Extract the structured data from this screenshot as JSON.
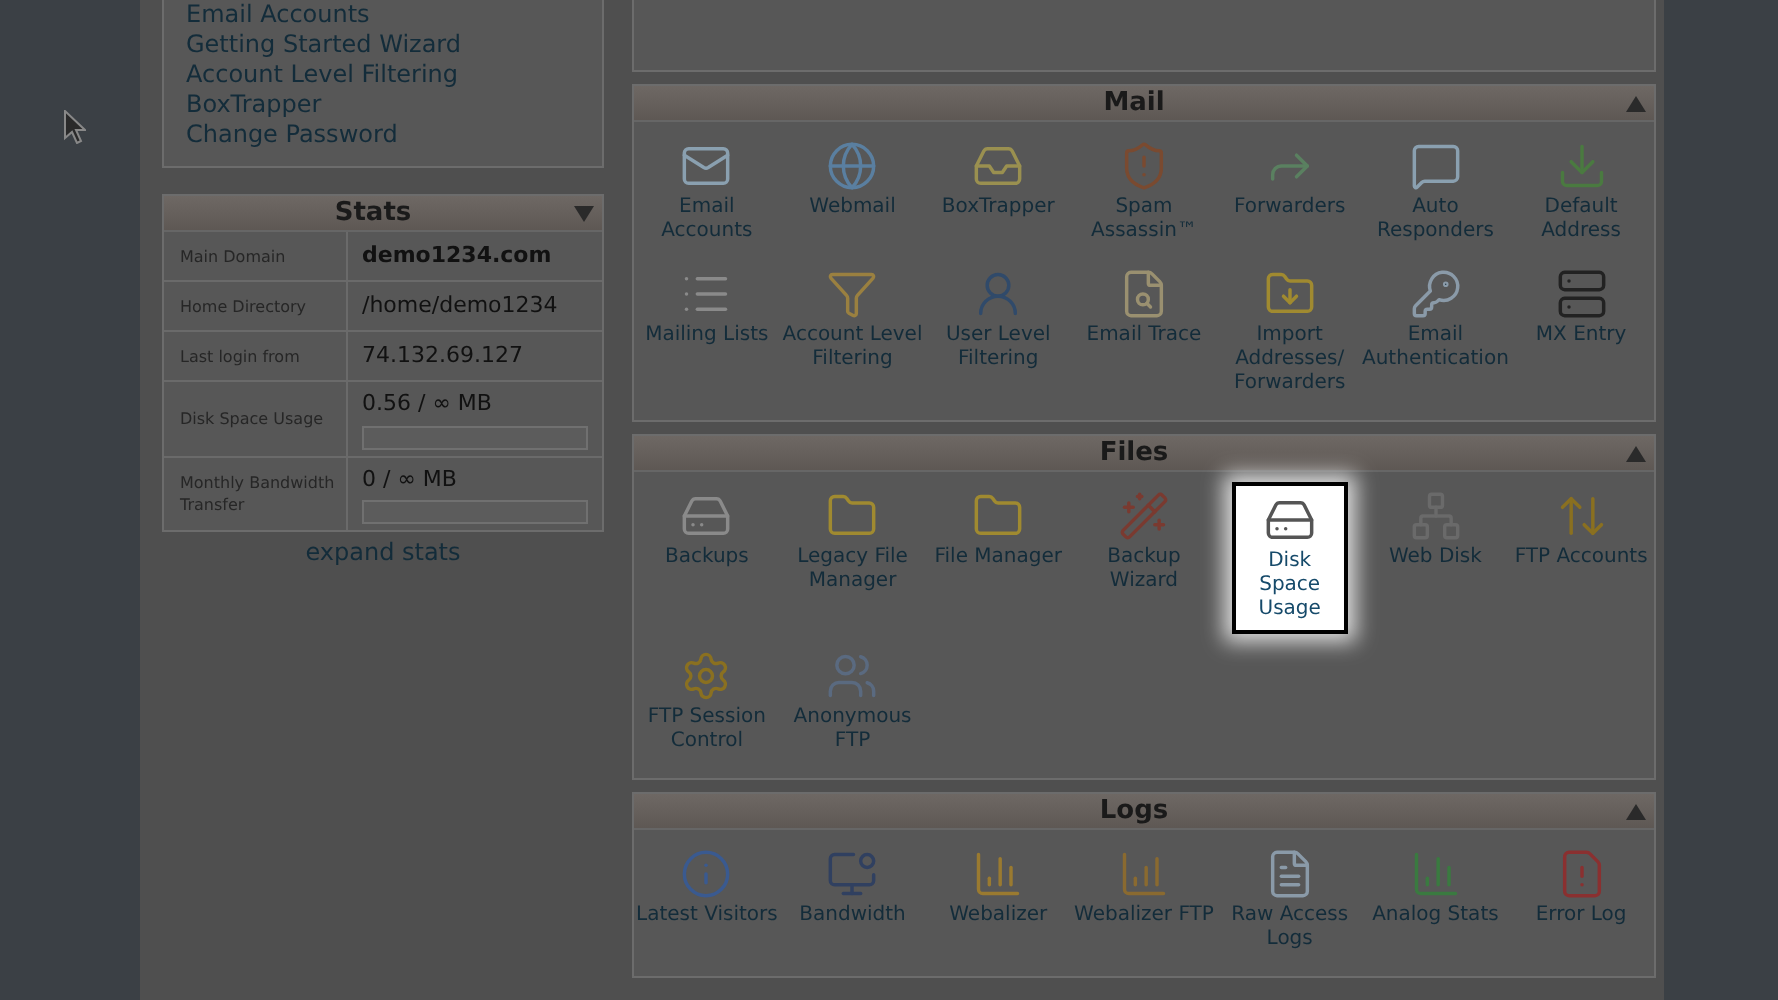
{
  "links": [
    "Email Accounts",
    "Getting Started Wizard",
    "Account Level Filtering",
    "BoxTrapper",
    "Change Password"
  ],
  "stats": {
    "title": "Stats",
    "rows": [
      {
        "label": "Main Domain",
        "value": "demo1234.com",
        "kind": "bold"
      },
      {
        "label": "Home Directory",
        "value": "/home/demo1234",
        "kind": "text"
      },
      {
        "label": "Last login from",
        "value": "74.132.69.127",
        "kind": "text"
      },
      {
        "label": "Disk Space Usage",
        "value": "0.56 / ∞ MB",
        "kind": "meter",
        "level": 0
      },
      {
        "label": "Monthly Bandwidth Transfer",
        "value": "0 / ∞ MB",
        "kind": "meter",
        "level": 0
      }
    ],
    "expand": "expand stats"
  },
  "sections": [
    {
      "title": "Mail",
      "items": [
        {
          "label": "Email Accounts",
          "selected": false
        },
        {
          "label": "Webmail",
          "selected": false
        },
        {
          "label": "BoxTrapper",
          "selected": false
        },
        {
          "label": "Spam Assassin™",
          "selected": false
        },
        {
          "label": "Forwarders",
          "selected": false
        },
        {
          "label": "Auto Responders",
          "selected": false
        },
        {
          "label": "Default Address",
          "selected": false
        },
        {
          "label": "Mailing Lists",
          "selected": false
        },
        {
          "label": "Account Level Filtering",
          "selected": false
        },
        {
          "label": "User Level Filtering",
          "selected": false
        },
        {
          "label": "Email Trace",
          "selected": false
        },
        {
          "label": "Import Addresses/ Forwarders",
          "selected": false
        },
        {
          "label": "Email Authentication",
          "selected": false
        },
        {
          "label": "MX Entry",
          "selected": false
        }
      ]
    },
    {
      "title": "Files",
      "items": [
        {
          "label": "Backups",
          "selected": false
        },
        {
          "label": "Legacy File Manager",
          "selected": false
        },
        {
          "label": "File Manager",
          "selected": false
        },
        {
          "label": "Backup Wizard",
          "selected": false
        },
        {
          "label": "Disk Space Usage",
          "selected": true
        },
        {
          "label": "Web Disk",
          "selected": false
        },
        {
          "label": "FTP Accounts",
          "selected": false
        },
        {
          "label": "FTP Session Control",
          "selected": false
        },
        {
          "label": "Anonymous FTP",
          "selected": false
        }
      ]
    },
    {
      "title": "Logs",
      "items": [
        {
          "label": "Latest Visitors",
          "selected": false
        },
        {
          "label": "Bandwidth",
          "selected": false
        },
        {
          "label": "Webalizer",
          "selected": false
        },
        {
          "label": "Webalizer FTP",
          "selected": false
        },
        {
          "label": "Raw Access Logs",
          "selected": false
        },
        {
          "label": "Analog Stats",
          "selected": false
        },
        {
          "label": "Error Log",
          "selected": false
        }
      ]
    }
  ]
}
